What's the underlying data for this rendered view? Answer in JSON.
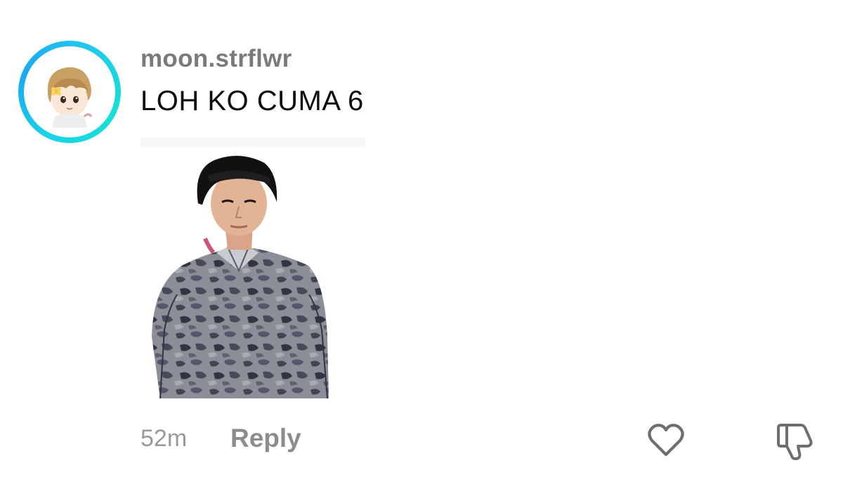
{
  "comment": {
    "username": "moon.strflwr",
    "text": "LOH KO CUMA 6",
    "timestamp": "52m",
    "reply_label": "Reply",
    "avatar_ring_color": "#1ac6ea",
    "like_icon": "heart-outline-icon",
    "dislike_icon": "thumbs-down-outline-icon",
    "sticker": "animated-sticker-person-in-camo-shirt"
  }
}
